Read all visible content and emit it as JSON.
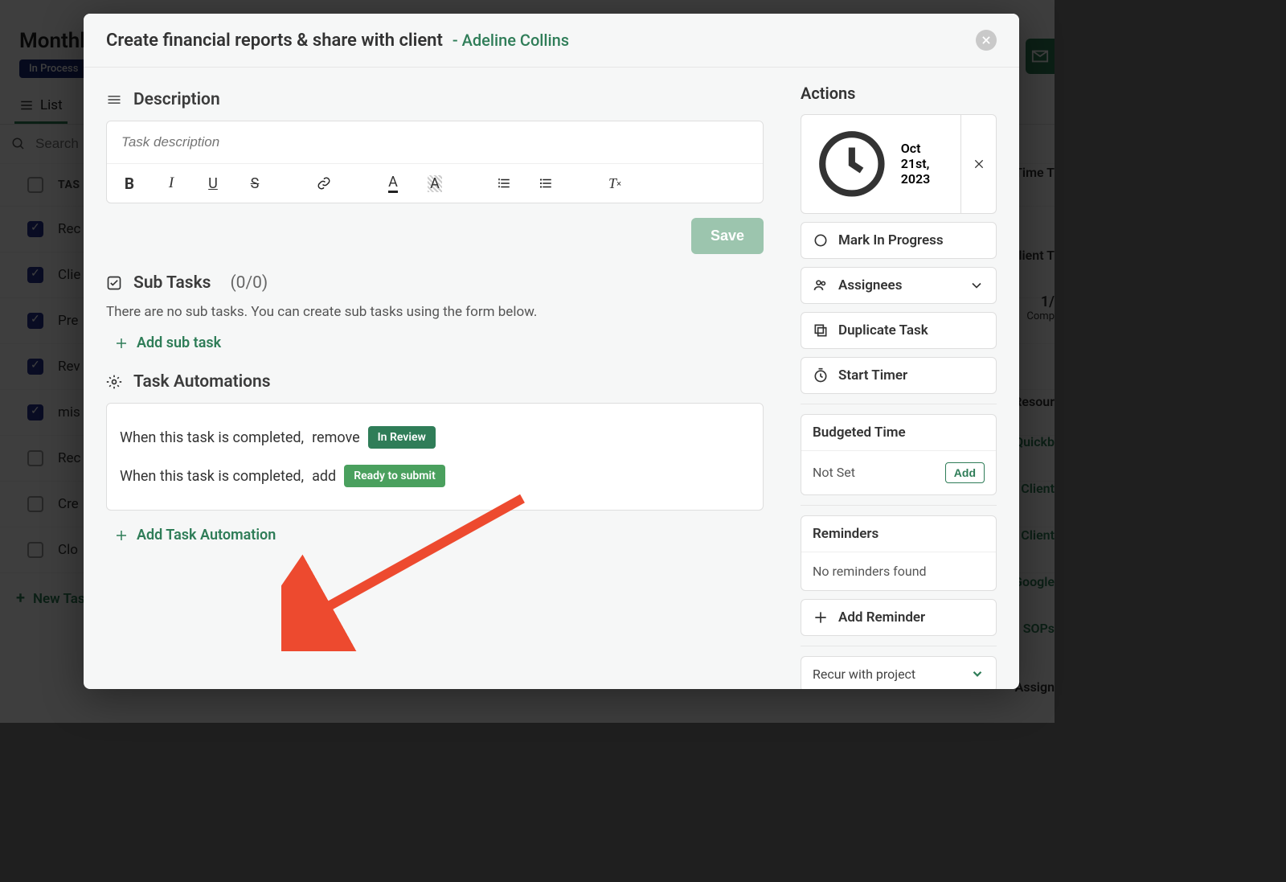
{
  "background": {
    "page_title": "Monthly",
    "status": "In Process",
    "tab_list": "List",
    "search_placeholder": "Search",
    "col_task": "TAS",
    "col_time": "Time T",
    "rows": [
      {
        "checked": true,
        "label": "Rec"
      },
      {
        "checked": true,
        "label": "Clie"
      },
      {
        "checked": true,
        "label": "Pre"
      },
      {
        "checked": true,
        "label": "Rev"
      },
      {
        "checked": true,
        "label": "mis"
      },
      {
        "checked": false,
        "label": "Rec"
      },
      {
        "checked": false,
        "label": "Cre"
      },
      {
        "checked": false,
        "label": "Clo"
      }
    ],
    "new_task": "New Tas",
    "right_labels": {
      "client": "Client T",
      "compl": "1/",
      "compl2": "Comp",
      "resour": "Resour",
      "quick": "Quickb",
      "clientl1": "Client",
      "clientl2": "Client",
      "google": "Google",
      "sops": "SOPs",
      "assign": "Assign"
    }
  },
  "modal": {
    "title": "Create financial reports & share with client",
    "owner_dash": "- ",
    "owner": "Adeline Collins",
    "description_heading": "Description",
    "description_placeholder": "Task description",
    "save_label": "Save",
    "subtasks_heading": "Sub Tasks",
    "subtasks_count": "(0/0)",
    "subtasks_empty": "There are no sub tasks. You can create sub tasks using the form below.",
    "add_subtask": "Add sub task",
    "automations_heading": "Task Automations",
    "automation_rows": [
      {
        "prefix": "When this task is completed,",
        "verb": "remove",
        "tag": "In Review",
        "tag_class": "in-review"
      },
      {
        "prefix": "When this task is completed,",
        "verb": "add",
        "tag": "Ready to submit",
        "tag_class": "ready"
      }
    ],
    "add_automation": "Add Task Automation"
  },
  "side": {
    "actions_heading": "Actions",
    "date": "Oct 21st, 2023",
    "mark_in_progress": "Mark In Progress",
    "assignees": "Assignees",
    "duplicate": "Duplicate Task",
    "start_timer": "Start Timer",
    "budgeted_heading": "Budgeted Time",
    "budgeted_value": "Not Set",
    "add_small": "Add",
    "reminders_heading": "Reminders",
    "reminders_empty": "No reminders found",
    "add_reminder": "Add Reminder",
    "recur": "Recur with project"
  }
}
